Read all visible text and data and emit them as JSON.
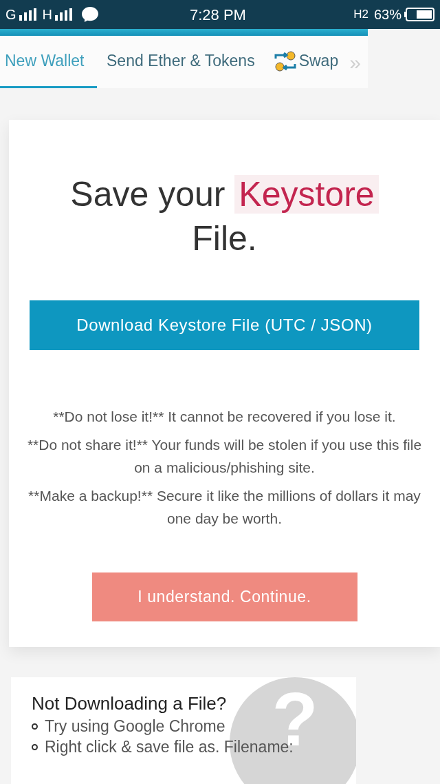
{
  "status_bar": {
    "network_1": "G",
    "network_2": "H",
    "time": "7:28 PM",
    "h2": "H2",
    "battery": "63%"
  },
  "tabs": [
    {
      "label": "New Wallet",
      "selected": true,
      "icon": false
    },
    {
      "label": "Send Ether & Tokens",
      "selected": false,
      "icon": false
    },
    {
      "label": "Swap",
      "selected": false,
      "icon": true
    }
  ],
  "more_tabs": "»",
  "card": {
    "title_start": "Save your",
    "title_highlight": "Keystore",
    "title_end": "File.",
    "download_button": "Download Keystore File (UTC / JSON)",
    "warnings": [
      "**Do not lose it!** It cannot be recovered if you lose it.",
      "**Do not share it!** Your funds will be stolen if you use this file on a malicious/phishing site.",
      "**Make a backup!** Secure it like the millions of dollars it may one day be worth."
    ],
    "continue_button": "I understand. Continue."
  },
  "help": {
    "title": "Not Downloading a File?",
    "question_mark": "?",
    "items": [
      "Try using Google Chrome",
      "Right click & save file as. Filename:"
    ]
  }
}
